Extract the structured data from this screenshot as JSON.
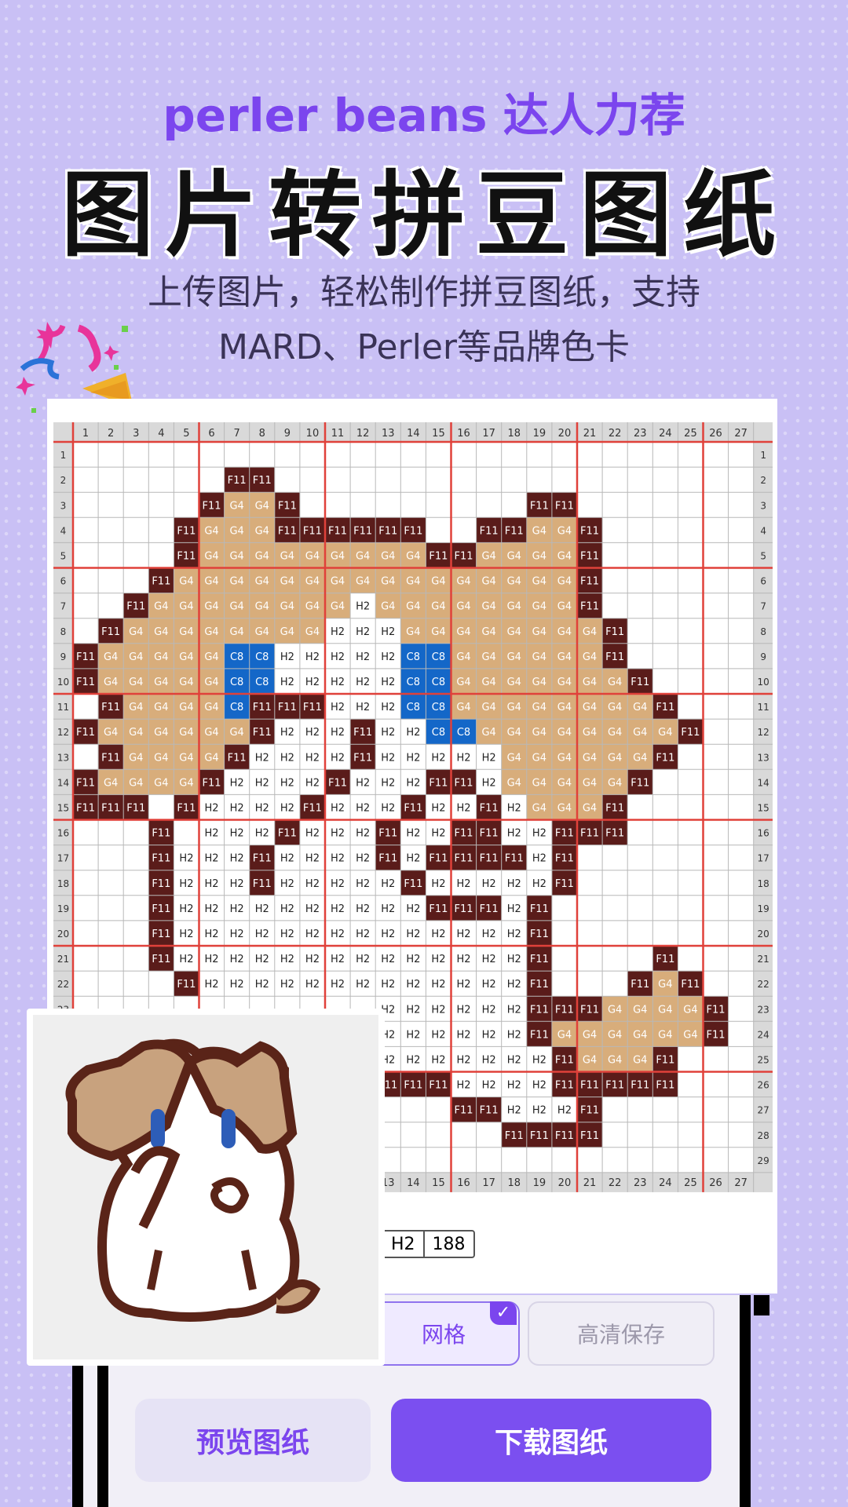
{
  "header": {
    "tagline": "perler beans 达人力荐",
    "title": "图片转拼豆图纸",
    "subtitle_line1": "上传图片，轻松制作拼豆图纸，支持",
    "subtitle_line2": "MARD、Perler等品牌色卡"
  },
  "pattern": {
    "columns": 27,
    "rows": 29,
    "visible_col_labels": [
      1,
      2,
      3,
      4,
      5,
      6,
      7,
      8,
      9,
      10,
      11,
      12,
      13,
      14,
      15,
      16,
      17,
      18,
      19,
      20,
      21,
      22,
      23,
      24,
      25,
      26,
      27
    ],
    "visible_row_labels": [
      1,
      2,
      3,
      4,
      5,
      6,
      7,
      8,
      9,
      10,
      11,
      12,
      13,
      14,
      15,
      16,
      17,
      18,
      19,
      20,
      21,
      22,
      23,
      24,
      25,
      26,
      27,
      28,
      29
    ],
    "colors": {
      "F11": "#5a1c1a",
      "G4": "#d8ad7b",
      "H2": "#ffffff",
      "C8": "#1467c8"
    },
    "grid": [
      "",
      "7:F11 8:F11",
      "6:F11 7:G4 8:G4 9:F11 19:F11 20:F11",
      "5:F11 6:G4 7:G4 8:G4 9:F11 10:F11 11:F11 12:F11 13:F11 14:F11 17:F11 18:F11 19:G4 20:G4 21:F11",
      "5:F11 6:G4 7:G4 8:G4 9:G4 10:G4 11:G4 12:G4 13:G4 14:G4 15:F11 16:F11 17:G4 18:G4 19:G4 20:G4 21:F11",
      "4:F11 5:G4 6:G4 7:G4 8:G4 9:G4 10:G4 11:G4 12:G4 13:G4 14:G4 15:G4 16:G4 17:G4 18:G4 19:G4 20:G4 21:F11",
      "3:F11 4:G4 5:G4 6:G4 7:G4 8:G4 9:G4 10:G4 11:G4 12:H2 13:G4 14:G4 15:G4 16:G4 17:G4 18:G4 19:G4 20:G4 21:F11",
      "2:F11 3:G4 4:G4 5:G4 6:G4 7:G4 8:G4 9:G4 10:G4 11:H2 12:H2 13:H2 14:G4 15:G4 16:G4 17:G4 18:G4 19:G4 20:G4 21:G4 22:F11",
      "1:F11 2:G4 3:G4 4:G4 5:G4 6:G4 7:C8 8:C8 9:H2 10:H2 11:H2 12:H2 13:H2 14:C8 15:C8 16:G4 17:G4 18:G4 19:G4 20:G4 21:G4 22:F11",
      "1:F11 2:G4 3:G4 4:G4 5:G4 6:G4 7:C8 8:C8 9:H2 10:H2 11:H2 12:H2 13:H2 14:C8 15:C8 16:G4 17:G4 18:G4 19:G4 20:G4 21:G4 22:G4 23:F11",
      "2:F11 3:G4 4:G4 5:G4 6:G4 7:C8 8:F11 9:F11 10:F11 11:H2 12:H2 13:H2 14:C8 15:C8 16:G4 17:G4 18:G4 19:G4 20:G4 21:G4 22:G4 23:G4 24:F11",
      "1:F11 2:G4 3:G4 4:G4 5:G4 6:G4 7:G4 8:F11 9:H2 10:H2 11:H2 12:F11 13:H2 14:H2 15:C8 16:C8 17:G4 18:G4 19:G4 20:G4 21:G4 22:G4 23:G4 24:G4 25:F11",
      "2:F11 3:G4 4:G4 5:G4 6:G4 7:F11 8:H2 9:H2 10:H2 11:H2 12:F11 13:H2 14:H2 15:H2 16:H2 17:H2 18:G4 19:G4 20:G4 21:G4 22:G4 23:G4 24:F11",
      "1:F11 2:G4 3:G4 4:G4 5:G4 6:F11 7:H2 8:H2 9:H2 10:H2 11:F11 12:H2 13:H2 14:H2 15:F11 16:F11 17:H2 18:G4 19:G4 20:G4 21:G4 22:G4 23:F11",
      "1:F11 2:F11 3:F11 5:F11 6:H2 7:H2 8:H2 9:H2 10:F11 11:H2 12:H2 13:H2 14:F11 15:H2 16:H2 17:F11 18:H2 19:G4 20:G4 21:G4 22:F11",
      "4:F11 6:H2 7:H2 8:H2 9:F11 10:H2 11:H2 12:H2 13:F11 14:H2 15:H2 16:F11 17:F11 18:H2 19:H2 20:F11 21:F11 22:F11",
      "4:F11 5:H2 6:H2 7:H2 8:F11 9:H2 10:H2 11:H2 12:H2 13:F11 14:H2 15:F11 16:F11 17:F11 18:F11 19:H2 20:F11",
      "4:F11 5:H2 6:H2 7:H2 8:F11 9:H2 10:H2 11:H2 12:H2 13:H2 14:F11 15:H2 16:H2 17:H2 18:H2 19:H2 20:F11",
      "4:F11 5:H2 6:H2 7:H2 8:H2 9:H2 10:H2 11:H2 12:H2 13:H2 14:H2 15:F11 16:F11 17:F11 18:H2 19:F11",
      "4:F11 5:H2 6:H2 7:H2 8:H2 9:H2 10:H2 11:H2 12:H2 13:H2 14:H2 15:H2 16:H2 17:H2 18:H2 19:F11",
      "4:F11 5:H2 6:H2 7:H2 8:H2 9:H2 10:H2 11:H2 12:H2 13:H2 14:H2 15:H2 16:H2 17:H2 18:H2 19:F11 24:F11",
      "5:F11 6:H2 7:H2 8:H2 9:H2 10:H2 11:H2 12:H2 13:H2 14:H2 15:H2 16:H2 17:H2 18:H2 19:F11 23:F11 24:G4 25:F11",
      "13:H2 14:H2 15:H2 16:H2 17:H2 18:H2 19:F11 20:F11 21:F11 22:G4 23:G4 24:G4 25:G4 26:F11",
      "13:H2 14:H2 15:H2 16:H2 17:H2 18:H2 19:F11 20:G4 21:G4 22:G4 23:G4 24:G4 25:G4 26:F11",
      "13:H2 14:H2 15:H2 16:H2 17:H2 18:H2 19:H2 20:F11 21:G4 22:G4 23:G4 24:F11",
      "13:F11 14:F11 15:F11 16:H2 17:H2 18:H2 19:H2 20:F11 21:F11 22:F11 23:F11 24:F11",
      "16:F11 17:F11 18:H2 19:H2 20:H2 21:F11",
      "18:F11 19:F11 20:F11 21:F11",
      ""
    ]
  },
  "color_count": {
    "code": "H2",
    "count": "188"
  },
  "options": {
    "grid_label": "网格",
    "hd_save_label": "高清保存",
    "check_glyph": "✓"
  },
  "actions": {
    "preview_label": "预览图纸",
    "download_label": "下载图纸"
  },
  "icons": {
    "confetti": "party-popper-icon",
    "check": "check-icon"
  }
}
